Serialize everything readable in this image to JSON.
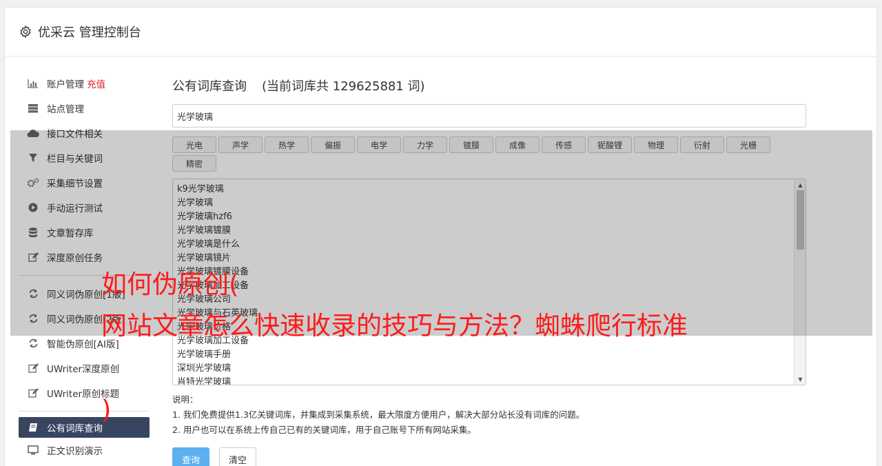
{
  "header": {
    "title": "优采云 管理控制台"
  },
  "sidebar": {
    "items": [
      {
        "label": "账户管理",
        "badge": "充值",
        "icon": "bar-chart-icon"
      },
      {
        "label": "站点管理",
        "icon": "server-icon"
      },
      {
        "label": "接口文件相关",
        "icon": "cloud-upload-icon"
      },
      {
        "label": "栏目与关键词",
        "icon": "filter-icon"
      },
      {
        "label": "采集细节设置",
        "icon": "gears-icon"
      },
      {
        "label": "手动运行测试",
        "icon": "play-circle-icon"
      },
      {
        "label": "文章暂存库",
        "icon": "database-icon"
      },
      {
        "label": "深度原创任务",
        "icon": "edit-icon"
      },
      {
        "label": "同义词伪原创[1版]",
        "icon": "refresh-icon"
      },
      {
        "label": "同义词伪原创[2版]",
        "icon": "refresh-icon"
      },
      {
        "label": "智能伪原创[AI版]",
        "icon": "refresh-icon"
      },
      {
        "label": "UWriter深度原创",
        "icon": "edit-icon"
      },
      {
        "label": "UWriter原创标题",
        "icon": "edit-icon"
      },
      {
        "label": "公有词库查询",
        "icon": "book-icon"
      },
      {
        "label": "正文识别演示",
        "icon": "monitor-icon"
      }
    ]
  },
  "main": {
    "title": "公有词库查询",
    "count_text": "(当前词库共 129625881 词)",
    "input_value": "光学玻璃",
    "tags": [
      "光电",
      "声学",
      "热学",
      "偏振",
      "电学",
      "力学",
      "镀膜",
      "成像",
      "传感",
      "铌酸锂",
      "物理",
      "衍射",
      "光栅",
      "精密"
    ],
    "results": [
      "k9光学玻璃",
      "光学玻璃",
      "光学玻璃hzf6",
      "光学玻璃镀膜",
      "光学玻璃是什么",
      "光学玻璃镜片",
      "光学玻璃镀膜设备",
      "光学玻璃加工设备",
      "光学玻璃公司",
      "光学玻璃与石英玻璃",
      "光学玻璃价格",
      "光学玻璃加工设备",
      "光学玻璃手册",
      "深圳光学玻璃",
      "肖特光学玻璃"
    ],
    "notes_title": "说明：",
    "notes": [
      "1. 我们免费提供1.3亿关键词库，并集成到采集系统，最大限度方便用户，解决大部分站长没有词库的问题。",
      "2. 用户也可以在系统上传自己已有的关键词库，用于自己账号下所有网站采集。"
    ],
    "query_button": "查询",
    "clear_button": "清空"
  },
  "overlay": {
    "line1": "如何伪原创(",
    "line2": "网站文章怎么快速收录的技巧与方法？蜘蛛爬行标准",
    "line3": ")"
  },
  "colors": {
    "active_bg": "#384561",
    "primary": "#5bb0f0",
    "overlay_text": "#ff1b1b",
    "badge": "#e02020"
  }
}
